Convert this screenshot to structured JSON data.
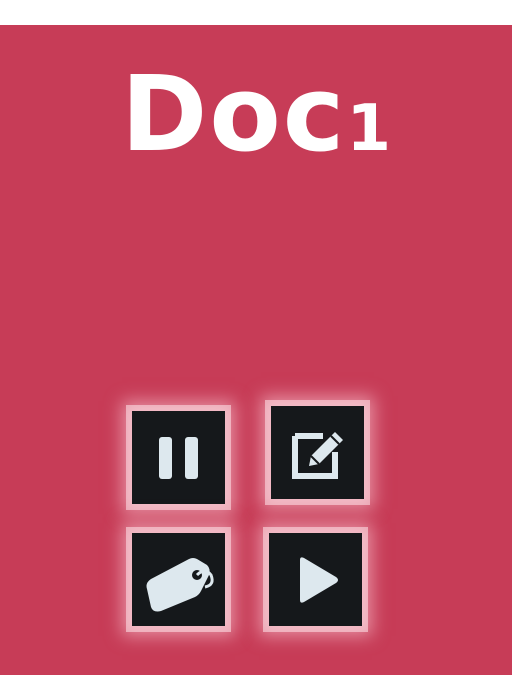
{
  "document": {
    "title_word": "Doc",
    "title_number": "1"
  },
  "controls": [
    {
      "name": "pause-button",
      "icon": "pause-icon"
    },
    {
      "name": "edit-button",
      "icon": "edit-icon"
    },
    {
      "name": "tag-button",
      "icon": "tag-icon"
    },
    {
      "name": "play-button",
      "icon": "play-icon"
    }
  ],
  "colors": {
    "background": "#c73c57",
    "tile": "#15181b",
    "icon": "#dde8ee",
    "title": "#ffffff"
  }
}
